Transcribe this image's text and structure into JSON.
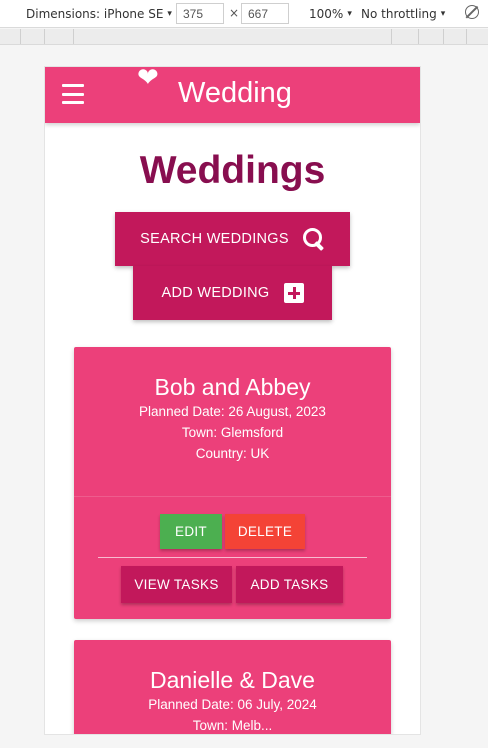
{
  "devtools": {
    "dimensions_label": "Dimensions: iPhone SE",
    "width_value": "375",
    "times": "×",
    "height_value": "667",
    "zoom": "100%",
    "throttling": "No throttling",
    "caret": "▾"
  },
  "navbar": {
    "brand": "Wedding",
    "heart": "❤"
  },
  "page": {
    "title": "Weddings",
    "search_label": "SEARCH WEDDINGS",
    "add_label": "ADD WEDDING"
  },
  "weddings": [
    {
      "name": "Bob and Abbey",
      "planned_date": "Planned Date: 26 August, 2023",
      "town": "Town: Glemsford",
      "country": "Country: UK",
      "edit_label": "EDIT",
      "delete_label": "DELETE",
      "view_tasks_label": "VIEW TASKS",
      "add_tasks_label": "ADD TASKS"
    },
    {
      "name": "Danielle & Dave",
      "planned_date": "Planned Date: 06 July, 2024",
      "town": "Town: Melb..."
    }
  ],
  "colors": {
    "primary": "#ec407a",
    "primary_dark": "#c2185b",
    "title": "#880e4f",
    "edit": "#4caf50",
    "delete": "#f44336"
  },
  "icons": {
    "menu": "menu-icon",
    "heart": "heart-icon",
    "search": "search-icon",
    "plus": "plus-box-icon",
    "rotate": "rotate-icon"
  }
}
